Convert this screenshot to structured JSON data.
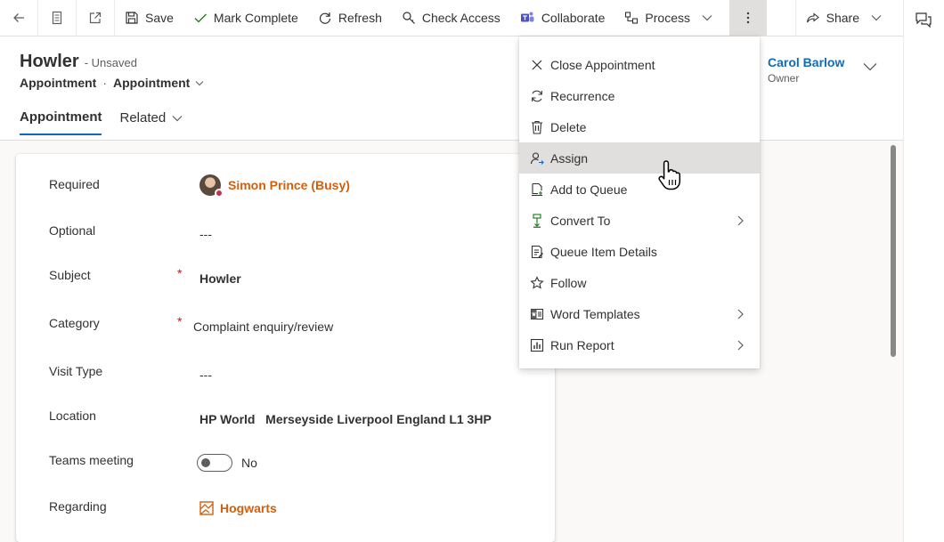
{
  "colors": {
    "accent": "#0f6cbd",
    "lookup": "#d35f0c",
    "required": "#a4262c",
    "presence_busy": "#c4314b",
    "menu_hover": "#e1dfdd"
  },
  "toolbar": {
    "back_icon": "back-arrow-icon",
    "form_icon": "record-page-icon",
    "popout_icon": "open-in-new-window-icon",
    "save": "Save",
    "mark_complete": "Mark Complete",
    "refresh": "Refresh",
    "check_access": "Check Access",
    "collaborate": "Collaborate",
    "process": "Process",
    "more_icon": "more-vertical-icon",
    "share": "Share"
  },
  "record": {
    "name": "Howler",
    "status": "- Unsaved",
    "entity": "Appointment",
    "separator": "·",
    "form": "Appointment"
  },
  "tabs": [
    {
      "label": "Appointment",
      "active": true
    },
    {
      "label": "Related",
      "active": false
    }
  ],
  "owner": {
    "name": "Carol Barlow",
    "label": "Owner"
  },
  "fields": {
    "required": {
      "label": "Required",
      "value": "Simon Prince (Busy)"
    },
    "optional": {
      "label": "Optional",
      "value": "---"
    },
    "subject": {
      "label": "Subject",
      "required_mark": "*",
      "value": "Howler"
    },
    "category": {
      "label": "Category",
      "required_mark": "*",
      "value": "Complaint enquiry/review"
    },
    "visit_type": {
      "label": "Visit Type",
      "value": "---"
    },
    "location": {
      "label": "Location",
      "value": "HP World   Merseyside Liverpool England L1 3HP"
    },
    "teams_meeting": {
      "label": "Teams meeting",
      "value": "No",
      "on": false
    },
    "regarding": {
      "label": "Regarding",
      "value": "Hogwarts"
    }
  },
  "menu": {
    "items": [
      {
        "label": "Close Appointment",
        "icon": "close-icon",
        "submenu": false
      },
      {
        "label": "Recurrence",
        "icon": "recurrence-icon",
        "submenu": false
      },
      {
        "label": "Delete",
        "icon": "trash-icon",
        "submenu": false
      },
      {
        "label": "Assign",
        "icon": "assign-user-icon",
        "submenu": false,
        "hover": true
      },
      {
        "label": "Add to Queue",
        "icon": "add-to-queue-icon",
        "submenu": false
      },
      {
        "label": "Convert To",
        "icon": "convert-icon",
        "submenu": true
      },
      {
        "label": "Queue Item Details",
        "icon": "queue-details-icon",
        "submenu": false
      },
      {
        "label": "Follow",
        "icon": "star-icon",
        "submenu": false
      },
      {
        "label": "Word Templates",
        "icon": "word-template-icon",
        "submenu": true
      },
      {
        "label": "Run Report",
        "icon": "report-icon",
        "submenu": true
      }
    ]
  }
}
